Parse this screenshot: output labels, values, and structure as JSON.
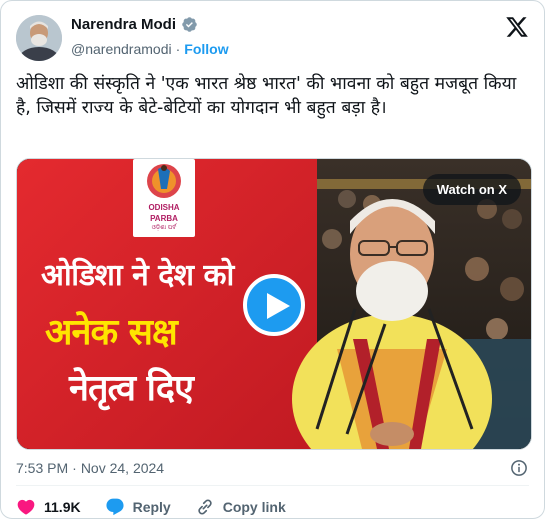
{
  "author": {
    "name": "Narendra Modi",
    "handle": "@narendramodi",
    "separator": "·",
    "follow_label": "Follow"
  },
  "tweet_text": "ओडिशा की संस्कृति ने 'एक भारत श्रेष्ठ भारत' की भावना को बहुत मजबूत किया है, जिसमें राज्य के बेटे-बेटियों का योगदान भी बहुत बड़ा है।",
  "media": {
    "watch_label": "Watch on X",
    "overlay_line1": "ओडिशा ने देश को",
    "overlay_line2": "अनेक सक्ष",
    "overlay_line3": "नेतृत्व दिए",
    "logo_line1": "ODISHA",
    "logo_line2": "PARBA",
    "logo_line3": "ଓଡ଼ିଶା ପର୍ବ"
  },
  "meta": {
    "time": "7:53 PM",
    "separator": "·",
    "date": "Nov 24, 2024"
  },
  "actions": {
    "likes": "11.9K",
    "reply_label": "Reply",
    "copy_label": "Copy link"
  },
  "colors": {
    "accent": "#1d9bf0",
    "like": "#f91880",
    "banner_red": "#d7232a",
    "banner_yellow": "#ffe500"
  }
}
